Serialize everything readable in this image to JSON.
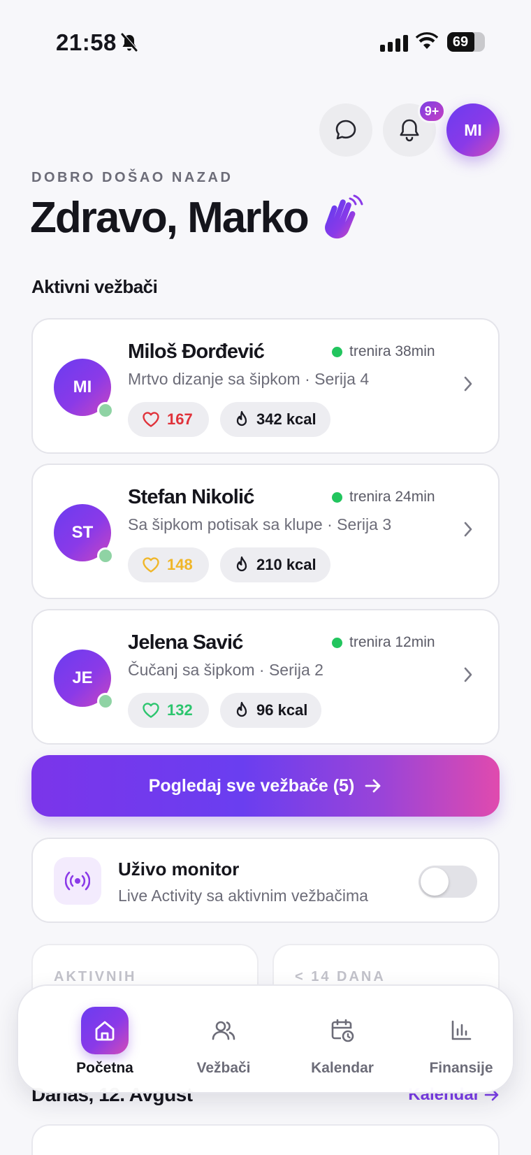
{
  "status_bar": {
    "time": "21:58",
    "battery": "69"
  },
  "header": {
    "notification_badge": "9+",
    "avatar_initials": "MI"
  },
  "welcome_label": "DOBRO DOŠAO NAZAD",
  "greeting": "Zdravo, Marko",
  "greeting_emoji": "👋",
  "active_section_title": "Aktivni vežbači",
  "trainees": [
    {
      "initials": "MI",
      "name": "Miloš Đorđević",
      "status": "trenira 38min",
      "exercise": "Mrtvo dizanje sa šipkom · Serija 4",
      "heart_rate": "167",
      "heart_color": "#e0323a",
      "calories": "342 kcal"
    },
    {
      "initials": "ST",
      "name": "Stefan Nikolić",
      "status": "trenira 24min",
      "exercise": "Sa šipkom potisak sa klupe · Serija 3",
      "heart_rate": "148",
      "heart_color": "#f0b628",
      "calories": "210 kcal"
    },
    {
      "initials": "JE",
      "name": "Jelena Savić",
      "status": "trenira 12min",
      "exercise": "Čučanj sa šipkom · Serija 2",
      "heart_rate": "132",
      "heart_color": "#2cc56e",
      "calories": "96 kcal"
    }
  ],
  "view_all_button": "Pogledaj sve vežbače (5)",
  "live_monitor": {
    "title": "Uživo monitor",
    "subtitle": "Live Activity sa aktivnim vežbačima",
    "enabled": false
  },
  "stat_cards": [
    {
      "label": "AKTIVNIH"
    },
    {
      "label": "< 14 DANA"
    }
  ],
  "today_label": "Danas, 12. Avgust",
  "calendar_link": "Kalendar",
  "tabs": [
    {
      "label": "Početna",
      "icon": "home-icon",
      "active": true
    },
    {
      "label": "Vežbači",
      "icon": "users-icon",
      "active": false
    },
    {
      "label": "Kalendar",
      "icon": "calendar-clock-icon",
      "active": false
    },
    {
      "label": "Finansije",
      "icon": "bar-chart-icon",
      "active": false
    }
  ]
}
